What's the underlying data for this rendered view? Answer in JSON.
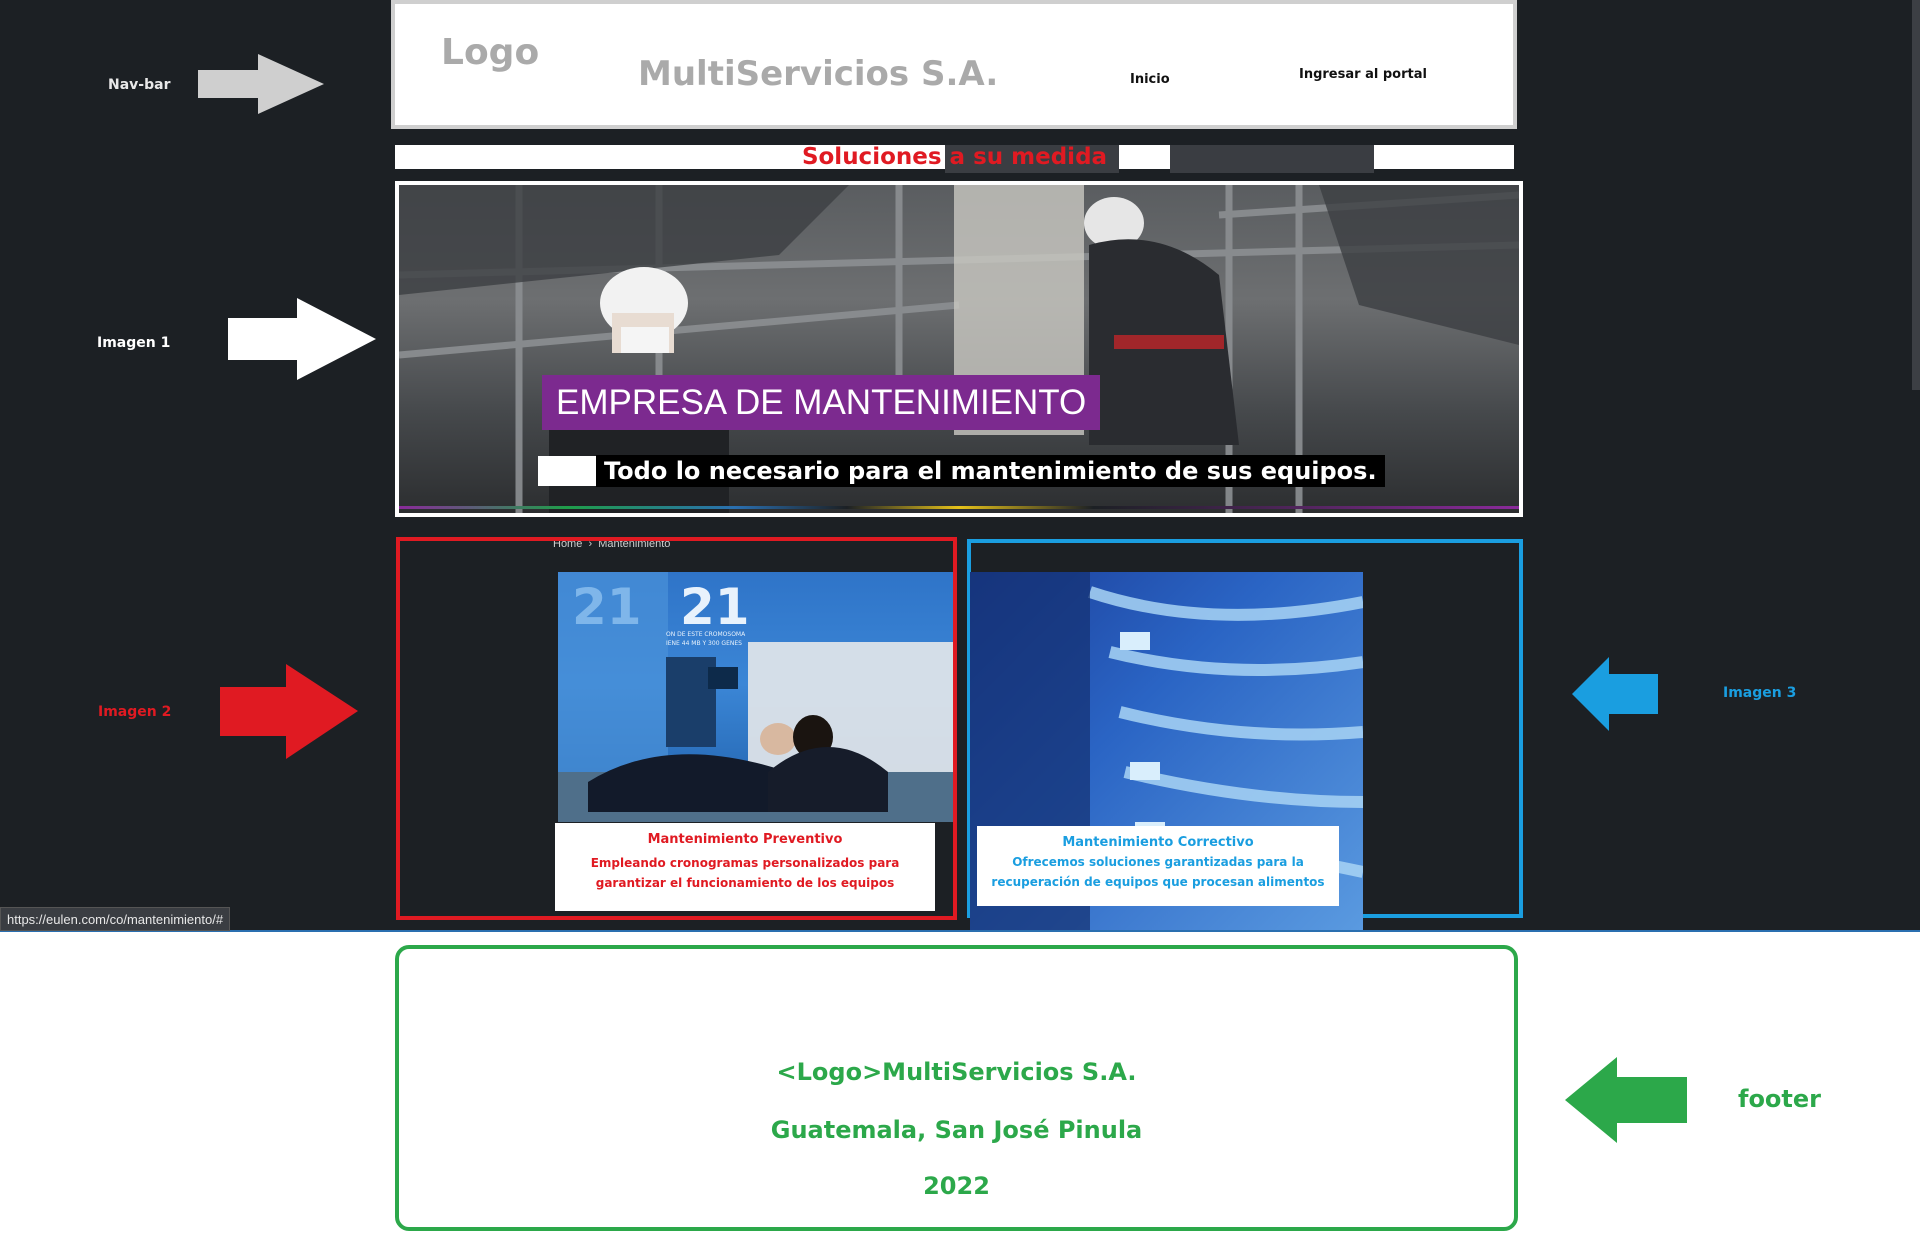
{
  "annotations": {
    "navbar_label": "Nav-bar",
    "image1_label": "Imagen 1",
    "image2_label": "Imagen 2",
    "image3_label": "Imagen 3",
    "footer_label": "footer",
    "colors": {
      "gray": "#cfcfcf",
      "white": "#ffffff",
      "red": "#e01a22",
      "blue": "#1a9ee0",
      "green": "#2ca84a"
    }
  },
  "navbar": {
    "logo": "Logo",
    "title": "MultiServicios S.A.",
    "links": [
      "Inicio",
      "Ingresar al portal"
    ]
  },
  "tagline": "Soluciones a su medida",
  "hero": {
    "title": "EMPRESA DE MANTENIMIENTO",
    "subtitle": "Todo lo necesario para el mantenimiento de sus equipos."
  },
  "breadcrumb": "Home  ›  Mantenimiento",
  "cards": [
    {
      "title": "Mantenimiento Preventivo",
      "description": "Empleando cronogramas personalizados para garantizar el funcionamiento de los equipos",
      "image_text": [
        "21",
        "21",
        "ON DE ESTE CROMOSOMA",
        "IENE 44 MB Y 300 GENES"
      ]
    },
    {
      "title": "Mantenimiento Correctivo",
      "description": "Ofrecemos soluciones garantizadas para la recuperación de equipos que procesan alimentos"
    }
  ],
  "status_url": "https://eulen.com/co/mantenimiento/#",
  "footer": {
    "line1": "<Logo>MultiServicios S.A.",
    "line2": "Guatemala, San José Pinula",
    "line3": "2022"
  }
}
